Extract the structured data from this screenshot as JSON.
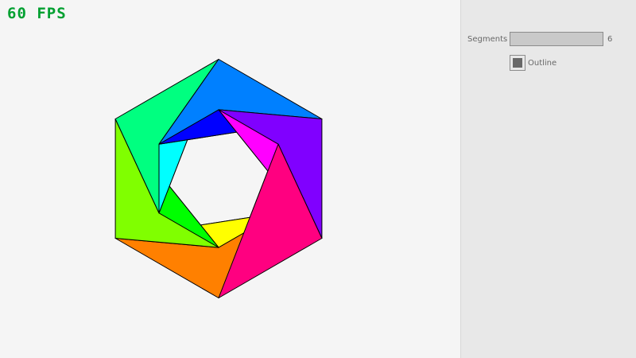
{
  "app": {
    "fps_text": "60 FPS",
    "fps_color": "#00a030"
  },
  "controls": {
    "segments_label": "Segments",
    "segments_value": "6",
    "outline_label": "Outline",
    "outline_checked": true
  },
  "shape": {
    "segments": 6,
    "outline": true,
    "colors": [
      "#ff0000",
      "#ff8000",
      "#ffff00",
      "#80ff00",
      "#00ff00",
      "#00ff80",
      "#00ffff",
      "#0080ff",
      "#0000ff",
      "#8000ff",
      "#ff00ff",
      "#ff0080"
    ]
  }
}
